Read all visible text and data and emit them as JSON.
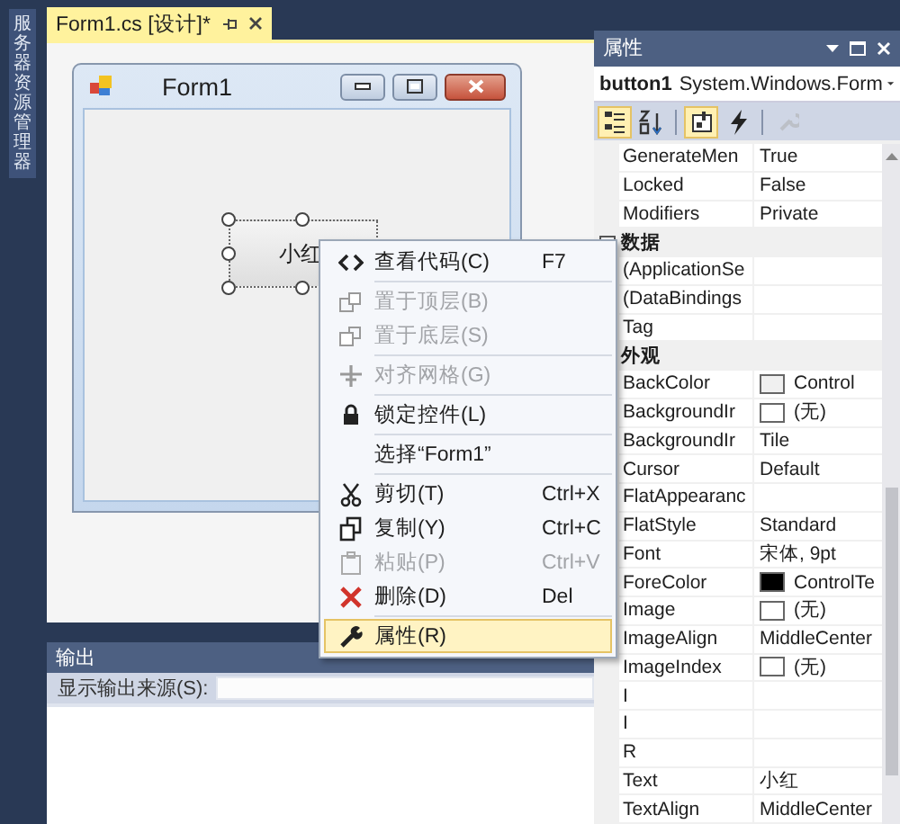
{
  "sidebar": {
    "tab": "服务器资源管理器"
  },
  "document_tab": {
    "title": "Form1.cs [设计]*"
  },
  "form": {
    "title": "Form1",
    "button": {
      "text": "小红",
      "selected": true
    }
  },
  "context_menu": [
    {
      "kind": "item",
      "label": "查看代码(C)",
      "shortcut": "F7",
      "disabled": false,
      "selected": false
    },
    {
      "kind": "separator"
    },
    {
      "kind": "item",
      "label": "置于顶层(B)",
      "disabled": true,
      "selected": false
    },
    {
      "kind": "item",
      "label": "置于底层(S)",
      "disabled": true,
      "selected": false
    },
    {
      "kind": "separator"
    },
    {
      "kind": "item",
      "label": "对齐网格(G)",
      "disabled": true,
      "selected": false
    },
    {
      "kind": "separator"
    },
    {
      "kind": "item",
      "label": "锁定控件(L)",
      "disabled": false,
      "selected": false
    },
    {
      "kind": "separator"
    },
    {
      "kind": "item",
      "label": "选择“Form1”",
      "disabled": false,
      "selected": false
    },
    {
      "kind": "separator"
    },
    {
      "kind": "item",
      "label": "剪切(T)",
      "shortcut": "Ctrl+X",
      "disabled": false,
      "selected": false
    },
    {
      "kind": "item",
      "label": "复制(Y)",
      "shortcut": "Ctrl+C",
      "disabled": false,
      "selected": false
    },
    {
      "kind": "item",
      "label": "粘贴(P)",
      "shortcut": "Ctrl+V",
      "disabled": true,
      "selected": false
    },
    {
      "kind": "item",
      "label": "删除(D)",
      "shortcut": "Del",
      "disabled": false,
      "selected": false
    },
    {
      "kind": "separator"
    },
    {
      "kind": "item",
      "label": "属性(R)",
      "disabled": false,
      "selected": true
    }
  ],
  "output": {
    "title": "输出",
    "source_label": "显示输出来源(S):"
  },
  "properties": {
    "title": "属性",
    "object": "button1",
    "type": "System.Windows.Form",
    "toolbar": [
      {
        "kind": "categorized",
        "selected": true,
        "disabled": false
      },
      {
        "kind": "alphabetical",
        "selected": false,
        "disabled": false
      },
      {
        "kind": "properties",
        "selected": true,
        "disabled": false
      },
      {
        "kind": "events",
        "selected": false,
        "disabled": false
      },
      {
        "kind": "pages",
        "selected": false,
        "disabled": true
      }
    ],
    "rows": [
      {
        "kind": "property",
        "name": "GenerateMen",
        "value": "True"
      },
      {
        "kind": "property",
        "name": "Locked",
        "value": "False"
      },
      {
        "kind": "property",
        "name": "Modifiers",
        "value": "Private"
      },
      {
        "kind": "category",
        "name": "数据",
        "expanded": true
      },
      {
        "kind": "property",
        "name": "(ApplicationSe"
      },
      {
        "kind": "property",
        "name": "(DataBindings"
      },
      {
        "kind": "property",
        "name": "Tag"
      },
      {
        "kind": "category",
        "name": "外观"
      },
      {
        "kind": "property",
        "name": "BackColor",
        "color": "#f0f0f0",
        "value": "Control"
      },
      {
        "kind": "property",
        "name": "BackgroundIr",
        "color": "#ffffff",
        "value": "(无)"
      },
      {
        "kind": "property",
        "name": "BackgroundIr",
        "value": "Tile"
      },
      {
        "kind": "property",
        "name": "Cursor",
        "value": "Default"
      },
      {
        "kind": "property",
        "name": "FlatAppearanc"
      },
      {
        "kind": "property",
        "name": "FlatStyle",
        "value": "Standard"
      },
      {
        "kind": "property",
        "name": "Font",
        "value": "宋体, 9pt"
      },
      {
        "kind": "property",
        "name": "ForeColor",
        "color": "#000000",
        "value": "ControlTe"
      },
      {
        "kind": "property",
        "name": "Image",
        "color": "#ffffff",
        "value": "(无)"
      },
      {
        "kind": "property",
        "name": "ImageAlign",
        "value": "MiddleCenter"
      },
      {
        "kind": "property",
        "name": "ImageIndex",
        "color": "#ffffff",
        "value": "(无)"
      },
      {
        "kind": "property",
        "name": "I"
      },
      {
        "kind": "property",
        "name": "I"
      },
      {
        "kind": "property",
        "name": "R"
      },
      {
        "kind": "property",
        "name": "Text",
        "value": "小红"
      },
      {
        "kind": "property",
        "name": "TextAlign",
        "value": "MiddleCenter"
      }
    ]
  }
}
